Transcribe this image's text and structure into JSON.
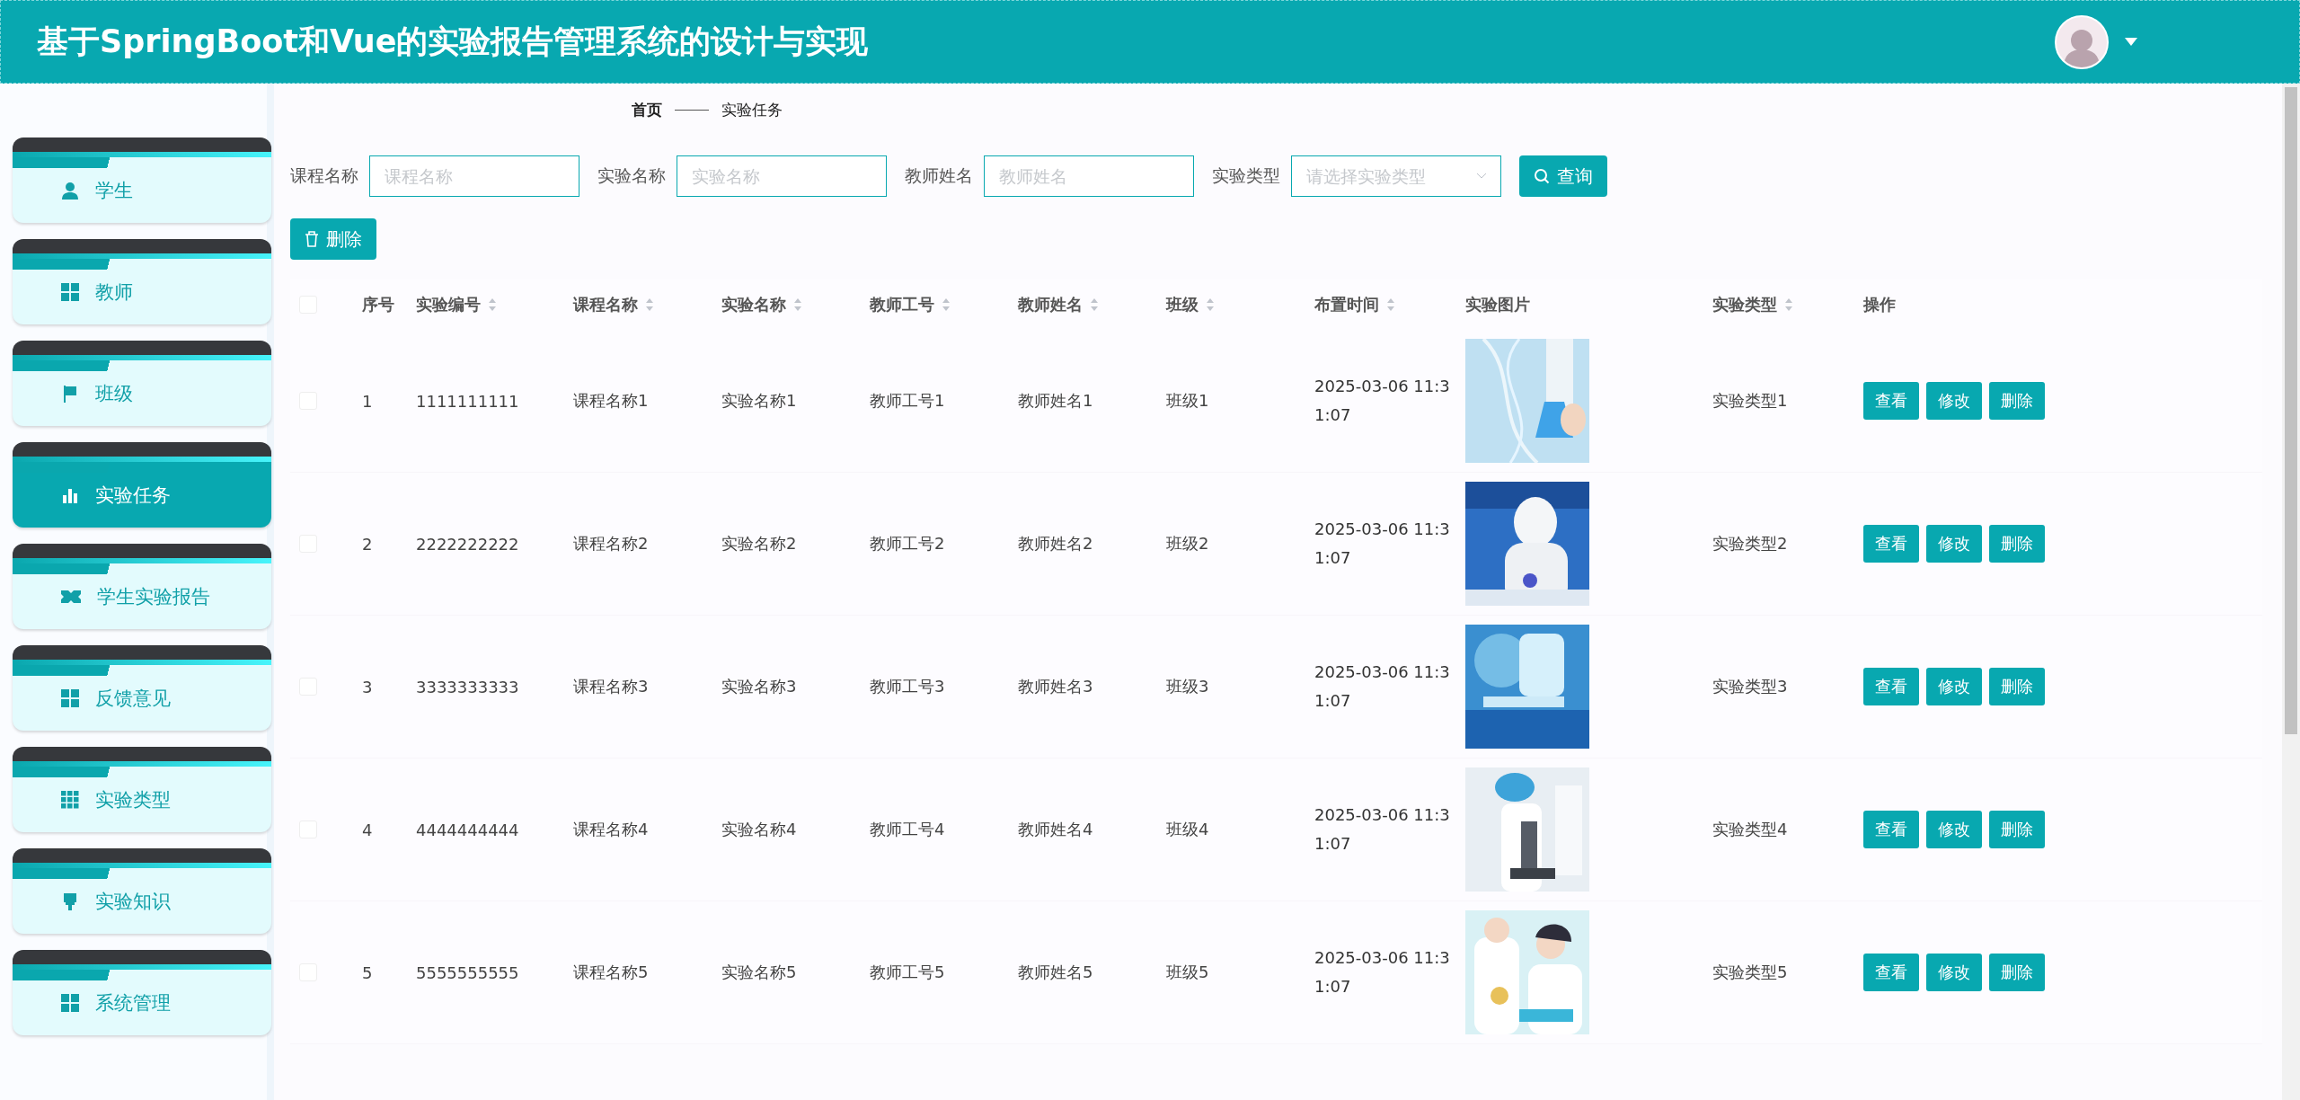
{
  "header": {
    "title": "基于SpringBoot和Vue的实验报告管理系统的设计与实现"
  },
  "sidebar": {
    "items": [
      {
        "label": "学生",
        "selected": false
      },
      {
        "label": "教师",
        "selected": false
      },
      {
        "label": "班级",
        "selected": false
      },
      {
        "label": "实验任务",
        "selected": true
      },
      {
        "label": "学生实验报告",
        "selected": false
      },
      {
        "label": "反馈意见",
        "selected": false
      },
      {
        "label": "实验类型",
        "selected": false
      },
      {
        "label": "实验知识",
        "selected": false
      },
      {
        "label": "系统管理",
        "selected": false
      }
    ]
  },
  "breadcrumb": [
    "首页",
    "实验任务"
  ],
  "search": {
    "fields": [
      {
        "label": "课程名称",
        "placeholder": "课程名称",
        "kind": "input"
      },
      {
        "label": "实验名称",
        "placeholder": "实验名称",
        "kind": "input"
      },
      {
        "label": "教师姓名",
        "placeholder": "教师姓名",
        "kind": "input"
      },
      {
        "label": "实验类型",
        "placeholder": "请选择实验类型",
        "kind": "select"
      }
    ],
    "button": "查询"
  },
  "delete_button": "删除",
  "table": {
    "select_all": {
      "checked": false
    },
    "columns": [
      {
        "label": "序号",
        "sortable": false
      },
      {
        "label": "实验编号",
        "sortable": true
      },
      {
        "label": "课程名称",
        "sortable": true
      },
      {
        "label": "实验名称",
        "sortable": true
      },
      {
        "label": "教师工号",
        "sortable": true
      },
      {
        "label": "教师姓名",
        "sortable": true
      },
      {
        "label": "班级",
        "sortable": true
      },
      {
        "label": "布置时间",
        "sortable": true
      },
      {
        "label": "实验图片",
        "sortable": false
      },
      {
        "label": "实验类型",
        "sortable": true
      },
      {
        "label": "操作",
        "sortable": false
      }
    ],
    "rows": [
      {
        "checked": false,
        "cells": [
          "1",
          "1111111111",
          "课程名称1",
          "实验名称1",
          "教师工号1",
          "教师姓名1",
          "班级1",
          "2025-03-06 11:31:07"
        ],
        "type": "实验类型1",
        "actions": [
          "查看",
          "修改",
          "删除"
        ]
      },
      {
        "checked": false,
        "cells": [
          "2",
          "2222222222",
          "课程名称2",
          "实验名称2",
          "教师工号2",
          "教师姓名2",
          "班级2",
          "2025-03-06 11:31:07"
        ],
        "type": "实验类型2",
        "actions": [
          "查看",
          "修改",
          "删除"
        ]
      },
      {
        "checked": false,
        "cells": [
          "3",
          "3333333333",
          "课程名称3",
          "实验名称3",
          "教师工号3",
          "教师姓名3",
          "班级3",
          "2025-03-06 11:31:07"
        ],
        "type": "实验类型3",
        "actions": [
          "查看",
          "修改",
          "删除"
        ]
      },
      {
        "checked": false,
        "cells": [
          "4",
          "4444444444",
          "课程名称4",
          "实验名称4",
          "教师工号4",
          "教师姓名4",
          "班级4",
          "2025-03-06 11:31:07"
        ],
        "type": "实验类型4",
        "actions": [
          "查看",
          "修改",
          "删除"
        ]
      },
      {
        "checked": false,
        "cells": [
          "5",
          "5555555555",
          "课程名称5",
          "实验名称5",
          "教师工号5",
          "教师姓名5",
          "班级5",
          "2025-03-06 11:31:07"
        ],
        "type": "实验类型5",
        "actions": [
          "查看",
          "修改",
          "删除"
        ]
      }
    ]
  }
}
